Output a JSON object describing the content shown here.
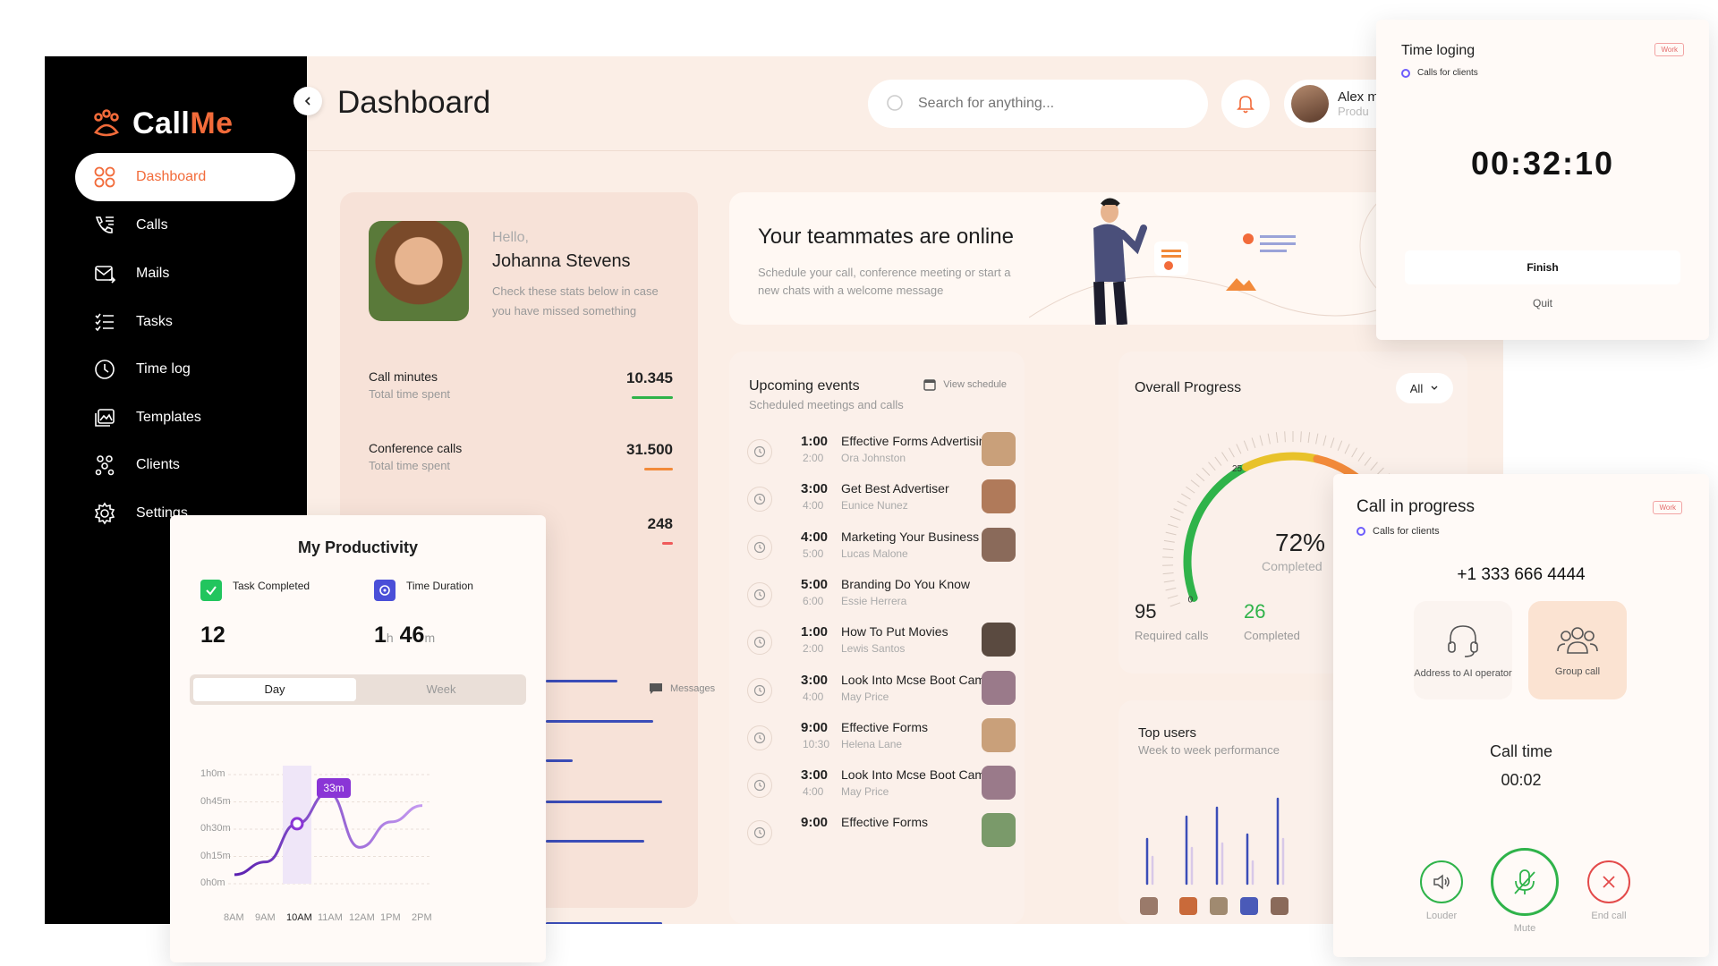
{
  "brand": {
    "call": "Call",
    "me": "Me"
  },
  "sidebar": {
    "items": [
      {
        "label": "Dashboard"
      },
      {
        "label": "Calls"
      },
      {
        "label": "Mails"
      },
      {
        "label": "Tasks"
      },
      {
        "label": "Time log"
      },
      {
        "label": "Templates"
      },
      {
        "label": "Clients"
      },
      {
        "label": "Settings"
      }
    ]
  },
  "header": {
    "title": "Dashboard",
    "search_placeholder": "Search for anything...",
    "user_name": "Alex m",
    "user_role": "Produ"
  },
  "hello": {
    "greeting": "Hello,",
    "name": "Johanna Stevens",
    "subtitle": "Check these stats below in case you have missed something",
    "stats": [
      {
        "title": "Call minutes",
        "sub": "Total time spent",
        "value": "10.345",
        "color": "#2fb34a"
      },
      {
        "title": "Conference calls",
        "sub": "Total time spent",
        "value": "31.500",
        "color": "#f28a3a"
      },
      {
        "title": "",
        "sub": "",
        "value": "248",
        "color": "#f05a5a"
      }
    ],
    "messages_link": "Messages"
  },
  "team": {
    "title": "Your teammates are online",
    "subtitle": "Schedule your call, conference meeting or start a new chats with a welcome message"
  },
  "events": {
    "title": "Upcoming events",
    "subtitle": "Scheduled meetings and calls",
    "view_schedule": "View schedule",
    "list": [
      {
        "time": "1:00",
        "end": "2:00",
        "name": "Effective Forms Advertising",
        "who": "Ora Johnston",
        "face": "#c9a07a"
      },
      {
        "time": "3:00",
        "end": "4:00",
        "name": "Get Best Advertiser",
        "who": "Eunice Nunez",
        "face": "#b07a5a"
      },
      {
        "time": "4:00",
        "end": "5:00",
        "name": "Marketing Your Business",
        "who": "Lucas Malone",
        "face": "#8a6a5a"
      },
      {
        "time": "5:00",
        "end": "6:00",
        "name": "Branding Do You Know",
        "who": "Essie Herrera",
        "face": ""
      },
      {
        "time": "1:00",
        "end": "2:00",
        "name": "How To Put Movies",
        "who": "Lewis Santos",
        "face": "#5a4a40"
      },
      {
        "time": "3:00",
        "end": "4:00",
        "name": "Look Into Mcse Boot Camps",
        "who": "May Price",
        "face": "#9a7a8a"
      },
      {
        "time": "9:00",
        "end": "10:30",
        "name": "Effective Forms",
        "who": "Helena Lane",
        "face": "#c9a07a"
      },
      {
        "time": "3:00",
        "end": "4:00",
        "name": "Look Into Mcse Boot Camps",
        "who": "May Price",
        "face": "#9a7a8a"
      },
      {
        "time": "9:00",
        "end": "",
        "name": "Effective Forms",
        "who": "",
        "face": "#7a9a6a"
      }
    ]
  },
  "progress": {
    "title": "Overall Progress",
    "filter": "All",
    "percent": 72,
    "percent_label": "72%",
    "completed_label": "Completed",
    "gauge_ticks": [
      "0",
      "25",
      "50"
    ],
    "required_value": "95",
    "required_label": "Required calls",
    "completed_value": "26",
    "completed_value_label": "Completed"
  },
  "top_users": {
    "title": "Top users",
    "subtitle": "Week to week performance"
  },
  "productivity": {
    "title": "My Productivity",
    "task_label": "Task Completed",
    "task_value": "12",
    "duration_label": "Time Duration",
    "duration_hours": "1",
    "duration_h_unit": "h",
    "duration_minutes": "46",
    "duration_m_unit": "m",
    "tab_day": "Day",
    "tab_week": "Week",
    "tooltip": "33m",
    "chart_data": {
      "type": "line",
      "categories": [
        "8AM",
        "9AM",
        "10AM",
        "11AM",
        "12AM",
        "1PM",
        "2PM"
      ],
      "y_ticks": [
        "1h0m",
        "0h45m",
        "0h30m",
        "0h15m",
        "0h0m"
      ],
      "ylim": [
        0,
        60
      ],
      "selected": "10AM",
      "series": [
        {
          "values": [
            5,
            12,
            33,
            50,
            20,
            34,
            43
          ]
        }
      ]
    }
  },
  "timelog": {
    "title": "Time loging",
    "subtitle": "Calls for clients",
    "badge": "Work",
    "time": "00:32:10",
    "finish": "Finish",
    "quit": "Quit"
  },
  "call": {
    "title": "Call in progress",
    "subtitle": "Calls for clients",
    "badge": "Work",
    "phone": "+1 333 666 4444",
    "option_ai": "Address to AI operator",
    "option_group": "Group call",
    "call_time_label": "Call time",
    "call_time": "00:02",
    "louder": "Louder",
    "mute": "Mute",
    "end": "End call"
  },
  "colors": {
    "accent": "#f26b3a",
    "green": "#2fb34a",
    "purple": "#8a35d6",
    "blue": "#3b4db8"
  }
}
